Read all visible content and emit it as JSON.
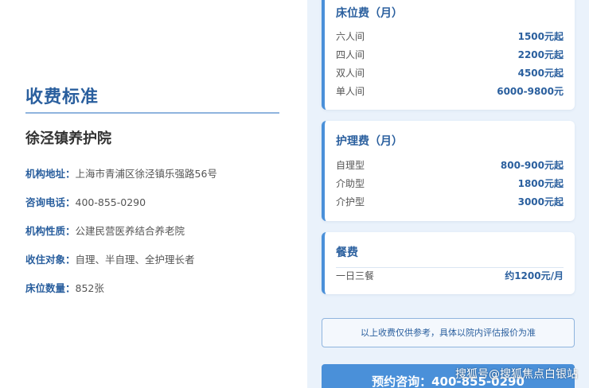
{
  "left": {
    "section_title": "收费标准",
    "org_name": "徐泾镇养护院",
    "info": [
      {
        "label": "机构地址：",
        "value": "上海市青浦区徐泾镇乐强路56号"
      },
      {
        "label": "咨询电话：",
        "value": "400-855-0290"
      },
      {
        "label": "机构性质：",
        "value": "公建民营医养结合养老院"
      },
      {
        "label": "收住对象：",
        "value": "自理、半自理、全护理长者"
      },
      {
        "label": "床位数量：",
        "value": "852张"
      }
    ]
  },
  "right": {
    "bed_fee": {
      "title": "床位费（月）",
      "items": [
        {
          "name": "六人间",
          "price": "1500元起"
        },
        {
          "name": "四人间",
          "price": "2200元起"
        },
        {
          "name": "双人间",
          "price": "4500元起"
        },
        {
          "name": "单人间",
          "price": "6000-9800元"
        }
      ]
    },
    "care_fee": {
      "title": "护理费（月）",
      "items": [
        {
          "name": "自理型",
          "price": "800-900元起"
        },
        {
          "name": "介助型",
          "price": "1800元起"
        },
        {
          "name": "介护型",
          "price": "3000元起"
        }
      ]
    },
    "meal_fee": {
      "title": "餐费",
      "items": [
        {
          "name": "一日三餐",
          "price": "约1200元/月"
        }
      ]
    },
    "note": "以上收费仅供参考，具体以院内评估报价为准",
    "cta": "预约咨询：400-855-0290"
  },
  "watermark": "搜狐号@搜狐焦点白银站",
  "colors": {
    "accent": "#2a5f9e",
    "button": "#4a90d9",
    "panel": "#eaf2fb"
  }
}
